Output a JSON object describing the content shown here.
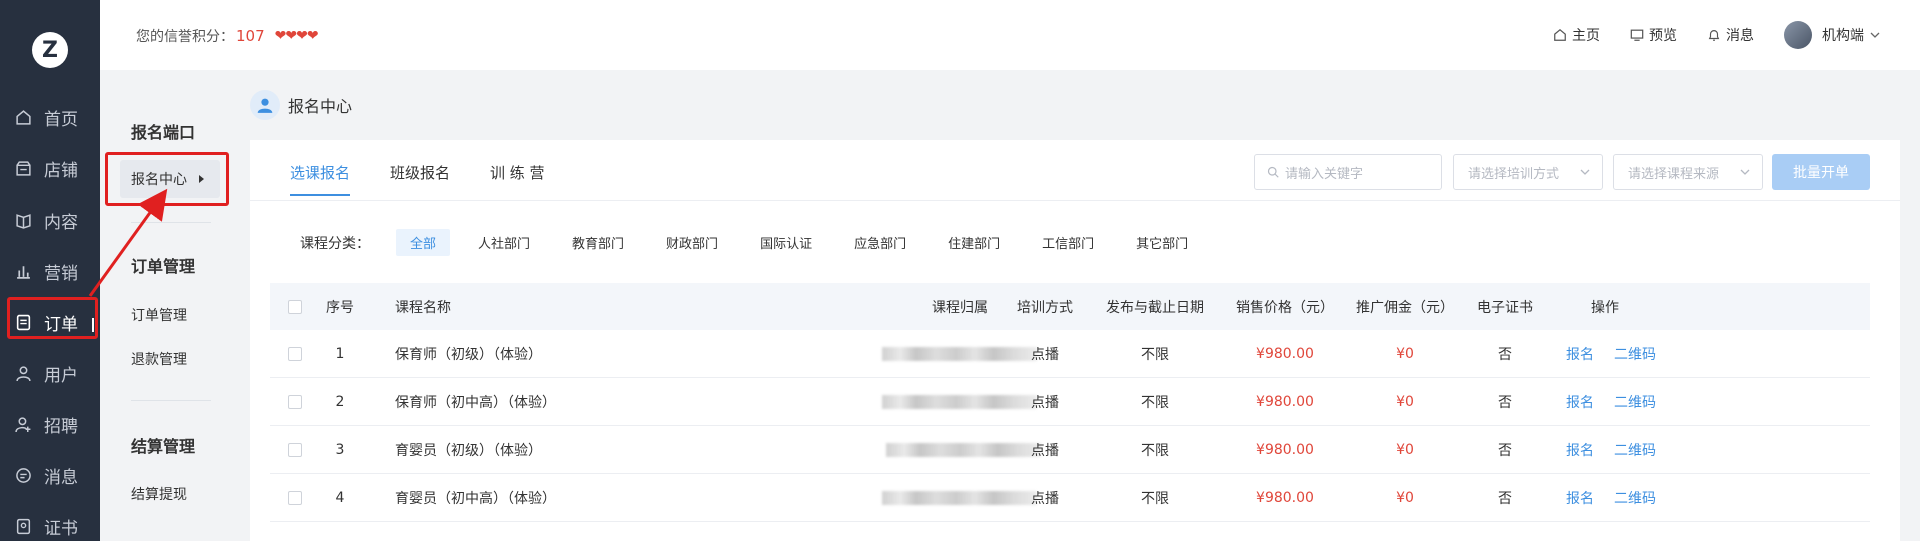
{
  "topbar": {
    "credit_label": "您的信誉积分：",
    "credit_score": "107",
    "hearts": "❤❤❤❤",
    "links": [
      {
        "label": "主页"
      },
      {
        "label": "预览"
      },
      {
        "label": "消息"
      }
    ],
    "user_name": "机构端"
  },
  "nav": {
    "logo": "Z",
    "items": [
      {
        "label": "首页"
      },
      {
        "label": "店铺"
      },
      {
        "label": "内容"
      },
      {
        "label": "营销"
      },
      {
        "label": "订单"
      },
      {
        "label": "用户"
      },
      {
        "label": "招聘"
      },
      {
        "label": "消息"
      },
      {
        "label": "证书"
      }
    ]
  },
  "sub": {
    "section1": "报名端口",
    "active_item": "报名中心",
    "section2": "订单管理",
    "item_order": "订单管理",
    "item_refund": "退款管理",
    "section3": "结算管理",
    "item_withdraw": "结算提现"
  },
  "page": {
    "title": "报名中心"
  },
  "tabs": [
    {
      "label": "选课报名"
    },
    {
      "label": "班级报名"
    },
    {
      "label": "训 练 营"
    }
  ],
  "filters": {
    "search_placeholder": "请输入关键字",
    "select_training": "请选择培训方式",
    "select_source": "请选择课程来源",
    "batch_button": "批量开单"
  },
  "categories": {
    "label": "课程分类：",
    "items": [
      "全部",
      "人社部门",
      "教育部门",
      "财政部门",
      "国际认证",
      "应急部门",
      "住建部门",
      "工信部门",
      "其它部门"
    ]
  },
  "table": {
    "headers": {
      "index": "序号",
      "name": "课程名称",
      "owner": "课程归属",
      "training": "培训方式",
      "date": "发布与截止日期",
      "price": "销售价格（元）",
      "commission": "推广佣金（元）",
      "cert": "电子证书",
      "actions": "操作"
    },
    "rows": [
      {
        "index": "1",
        "name": "保育师（初级）（体验）",
        "training": "点播",
        "date": "不限",
        "price": "¥980.00",
        "commission": "¥0",
        "cert": "否",
        "action1": "报名",
        "action2": "二维码"
      },
      {
        "index": "2",
        "name": "保育师（初中高）（体验）",
        "training": "点播",
        "date": "不限",
        "price": "¥980.00",
        "commission": "¥0",
        "cert": "否",
        "action1": "报名",
        "action2": "二维码"
      },
      {
        "index": "3",
        "name": "育婴员（初级）（体验）",
        "training": "点播",
        "date": "不限",
        "price": "¥980.00",
        "commission": "¥0",
        "cert": "否",
        "action1": "报名",
        "action2": "二维码"
      },
      {
        "index": "4",
        "name": "育婴员（初中高）（体验）",
        "training": "点播",
        "date": "不限",
        "price": "¥980.00",
        "commission": "¥0",
        "cert": "否",
        "action1": "报名",
        "action2": "二维码"
      }
    ]
  },
  "colors": {
    "accent": "#3d8fe0",
    "price": "#e0463a",
    "nav_bg": "#27303f",
    "annotation": "#e02020"
  }
}
